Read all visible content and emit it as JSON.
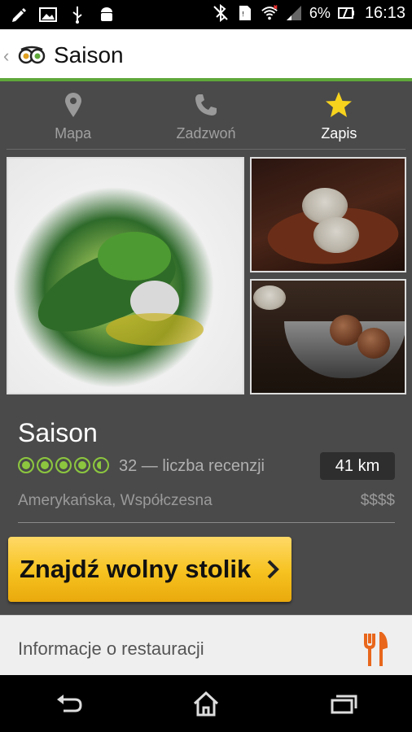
{
  "status_bar": {
    "battery_pct": "6%",
    "time": "16:13",
    "left_icons": [
      "edit-icon",
      "image-icon",
      "usb-icon",
      "android-icon"
    ],
    "right_icons": [
      "bluetooth-off-icon",
      "sim-icon",
      "wifi-icon",
      "signal-icon",
      "battery-icon"
    ]
  },
  "action_bar": {
    "title": "Saison",
    "logo": "tripadvisor-owl-icon"
  },
  "tabs": [
    {
      "label": "Mapa",
      "icon": "map-pin-icon",
      "active": false
    },
    {
      "label": "Zadzwoń",
      "icon": "phone-icon",
      "active": false
    },
    {
      "label": "Zapis",
      "icon": "star-icon",
      "active": true
    }
  ],
  "restaurant": {
    "name": "Saison",
    "rating": 4.5,
    "rating_max": 5,
    "reviews": "32 — liczba recenzji",
    "distance": "41 km",
    "cuisine": "Amerykańska, Współczesna",
    "price": "$$$$"
  },
  "cta": {
    "label": "Znajdź wolny stolik"
  },
  "info_section": {
    "label": "Informacje o restauracji",
    "icon": "fork-knife-icon"
  },
  "colors": {
    "accent_green": "#5fa83a",
    "bubble_green": "#8cc63f",
    "cta_yellow": "#f6c21f",
    "fork_orange": "#e8671c",
    "star_yellow": "#f7d31e"
  }
}
